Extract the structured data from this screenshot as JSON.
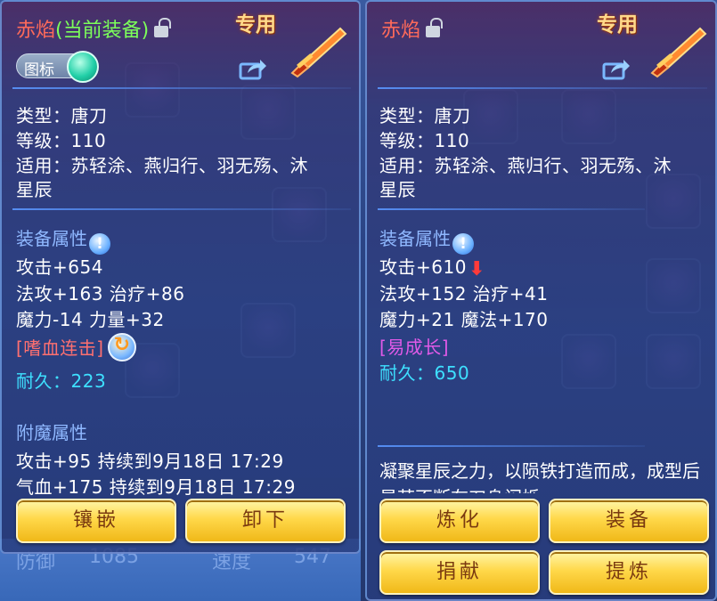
{
  "left": {
    "title_name": "赤焰",
    "title_status": "(当前装备)",
    "special_label": "专用",
    "icon_toggle_label": "图标",
    "type": "类型：唐刀",
    "level": "等级：110",
    "applicable_1": "适用：苏轻涂、燕归行、羽无殇、沐",
    "applicable_2": "星辰",
    "attr_heading": "装备属性",
    "attr_1": "攻击+654",
    "attr_2": "法攻+163 治疗+86",
    "attr_3": "魔力-14 力量+32",
    "skill": "[嗜血连击]",
    "durability": "耐久：223",
    "enchant_heading": "附魔属性",
    "enchant_1": "攻击+95 持续到9月18日 17:29",
    "enchant_2": "气血+175 持续到9月18日 17:29",
    "buttons": {
      "inlay": "镶嵌",
      "unequip": "卸下"
    }
  },
  "right": {
    "title_name": "赤焰",
    "special_label": "专用",
    "type": "类型：唐刀",
    "level": "等级：110",
    "applicable_1": "适用：苏轻涂、燕归行、羽无殇、沐",
    "applicable_2": "星辰",
    "attr_heading": "装备属性",
    "attr_1": "攻击+610",
    "attr_2": "法攻+152 治疗+41",
    "attr_3": "魔力+21 魔法+170",
    "skill": "[易成长]",
    "durability": "耐久：650",
    "description": "凝聚星辰之力，以陨铁打造而成，成型后星芒不断在刀身闪烁",
    "buttons": {
      "refine": "炼化",
      "equip": "装备",
      "donate": "捐献",
      "extract": "提炼"
    }
  },
  "background": {
    "stat_label_1": "防御",
    "stat_value_1": "1085",
    "stat_label_2": "速度",
    "stat_value_2": "547"
  },
  "colors": {
    "title_red": "#ff6a5a",
    "equipped_green": "#7cff5a",
    "section_blue": "#8fb8ff",
    "durability_cyan": "#3ee0ff",
    "button_gold": "#ffd84a"
  },
  "icons": [
    "lock-icon",
    "share-icon",
    "sword-icon",
    "info-icon",
    "refresh-icon",
    "down-arrow-icon",
    "toggle-knob"
  ]
}
